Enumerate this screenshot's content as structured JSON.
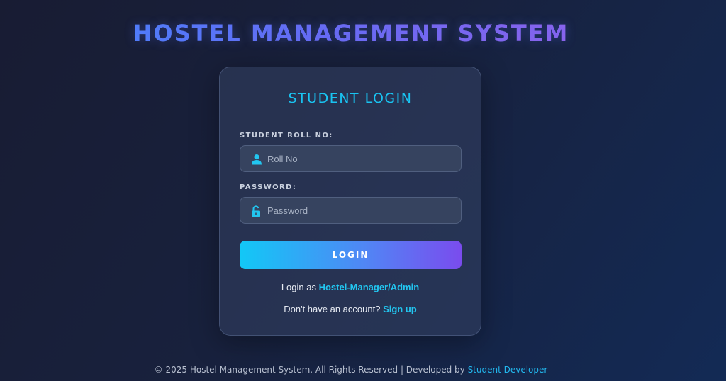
{
  "header": {
    "title": "HOSTEL MANAGEMENT SYSTEM"
  },
  "login_card": {
    "title": "STUDENT LOGIN",
    "roll": {
      "label": "STUDENT ROLL NO:",
      "placeholder": "Roll No",
      "value": "",
      "icon": "user-icon"
    },
    "password": {
      "label": "PASSWORD:",
      "placeholder": "Password",
      "value": "",
      "icon": "unlock-icon"
    },
    "login_button_label": "LOGIN",
    "admin_prefix": "Login as",
    "admin_link": "Hostel-Manager/Admin",
    "signup_prefix": "Don't have an account?",
    "signup_link": "Sign up"
  },
  "footer": {
    "text": "© 2025 Hostel Management System. All Rights Reserved | Developed by",
    "developer_link": "Student Developer"
  },
  "colors": {
    "accent_cyan": "#19c4f2",
    "accent_purple": "#7a4cee",
    "background": "#181c33"
  }
}
